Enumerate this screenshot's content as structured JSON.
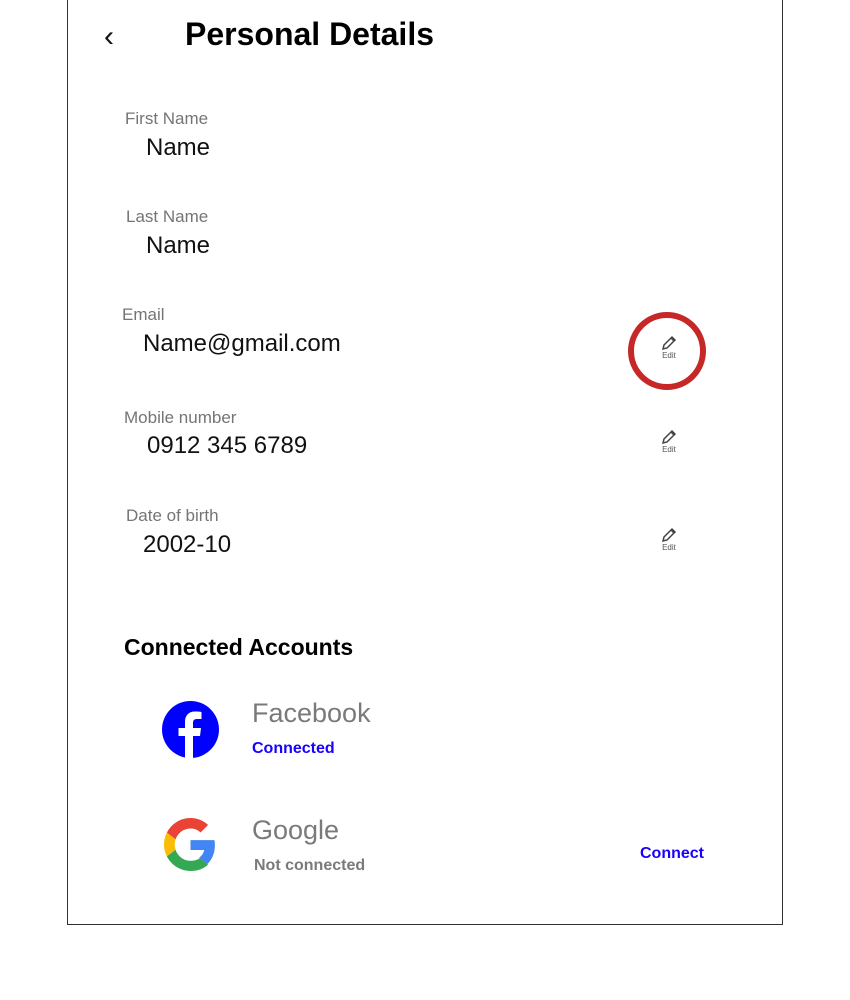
{
  "header": {
    "title": "Personal Details",
    "back_icon": "chevron-left-icon"
  },
  "fields": [
    {
      "label": "First Name",
      "value": "Name"
    },
    {
      "label": "Last Name",
      "value": "Name"
    },
    {
      "label": "Email",
      "value": "Name@gmail.com",
      "edit_label": "Edit"
    },
    {
      "label": "Mobile number",
      "value": "0912 345 6789",
      "edit_label": "Edit"
    },
    {
      "label": "Date of birth",
      "value": "2002-10",
      "edit_label": "Edit"
    }
  ],
  "connected_accounts": {
    "title": "Connected Accounts",
    "accounts": [
      {
        "name": "Facebook",
        "status": "Connected",
        "icon": "facebook-icon"
      },
      {
        "name": "Google",
        "status": "Not connected",
        "action": "Connect",
        "icon": "google-icon"
      }
    ]
  },
  "colors": {
    "link": "#1a00ff",
    "annotation": "#c62828",
    "facebook": "#0000ff"
  }
}
